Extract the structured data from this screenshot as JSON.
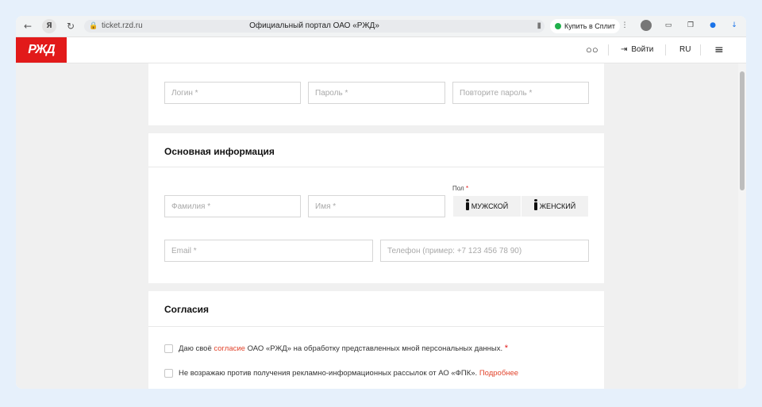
{
  "browser": {
    "url": "ticket.rzd.ru",
    "tab_title": "Официальный портал ОАО «РЖД»",
    "split_button": "Купить в Сплит",
    "yandex_badge": "Я"
  },
  "header": {
    "logo_text": "РЖД",
    "login_label": "Войти",
    "lang": "RU"
  },
  "credentials": {
    "login_placeholder": "Логин *",
    "password_placeholder": "Пароль *",
    "repeat_password_placeholder": "Повторите пароль *"
  },
  "basic_info": {
    "title": "Основная информация",
    "surname_placeholder": "Фамилия *",
    "name_placeholder": "Имя *",
    "sex_label": "Пол",
    "sex_required": "*",
    "male_label": "МУЖСКОЙ",
    "female_label": "ЖЕНСКИЙ",
    "email_placeholder": "Email *",
    "phone_placeholder": "Телефон (пример: +7 123 456 78 90)"
  },
  "consents": {
    "title": "Согласия",
    "consent1_prefix": "Даю своё",
    "consent1_link": "согласие",
    "consent1_suffix": "ОАО «РЖД» на обработку представленных мной персональных данных.",
    "consent1_required": "*",
    "consent2_text": "Не возражаю против получения рекламно-информационных рассылок от АО «ФПК».",
    "consent2_link": "Подробнее"
  },
  "colors": {
    "brand": "#e21a1a",
    "link": "#e2442c"
  }
}
